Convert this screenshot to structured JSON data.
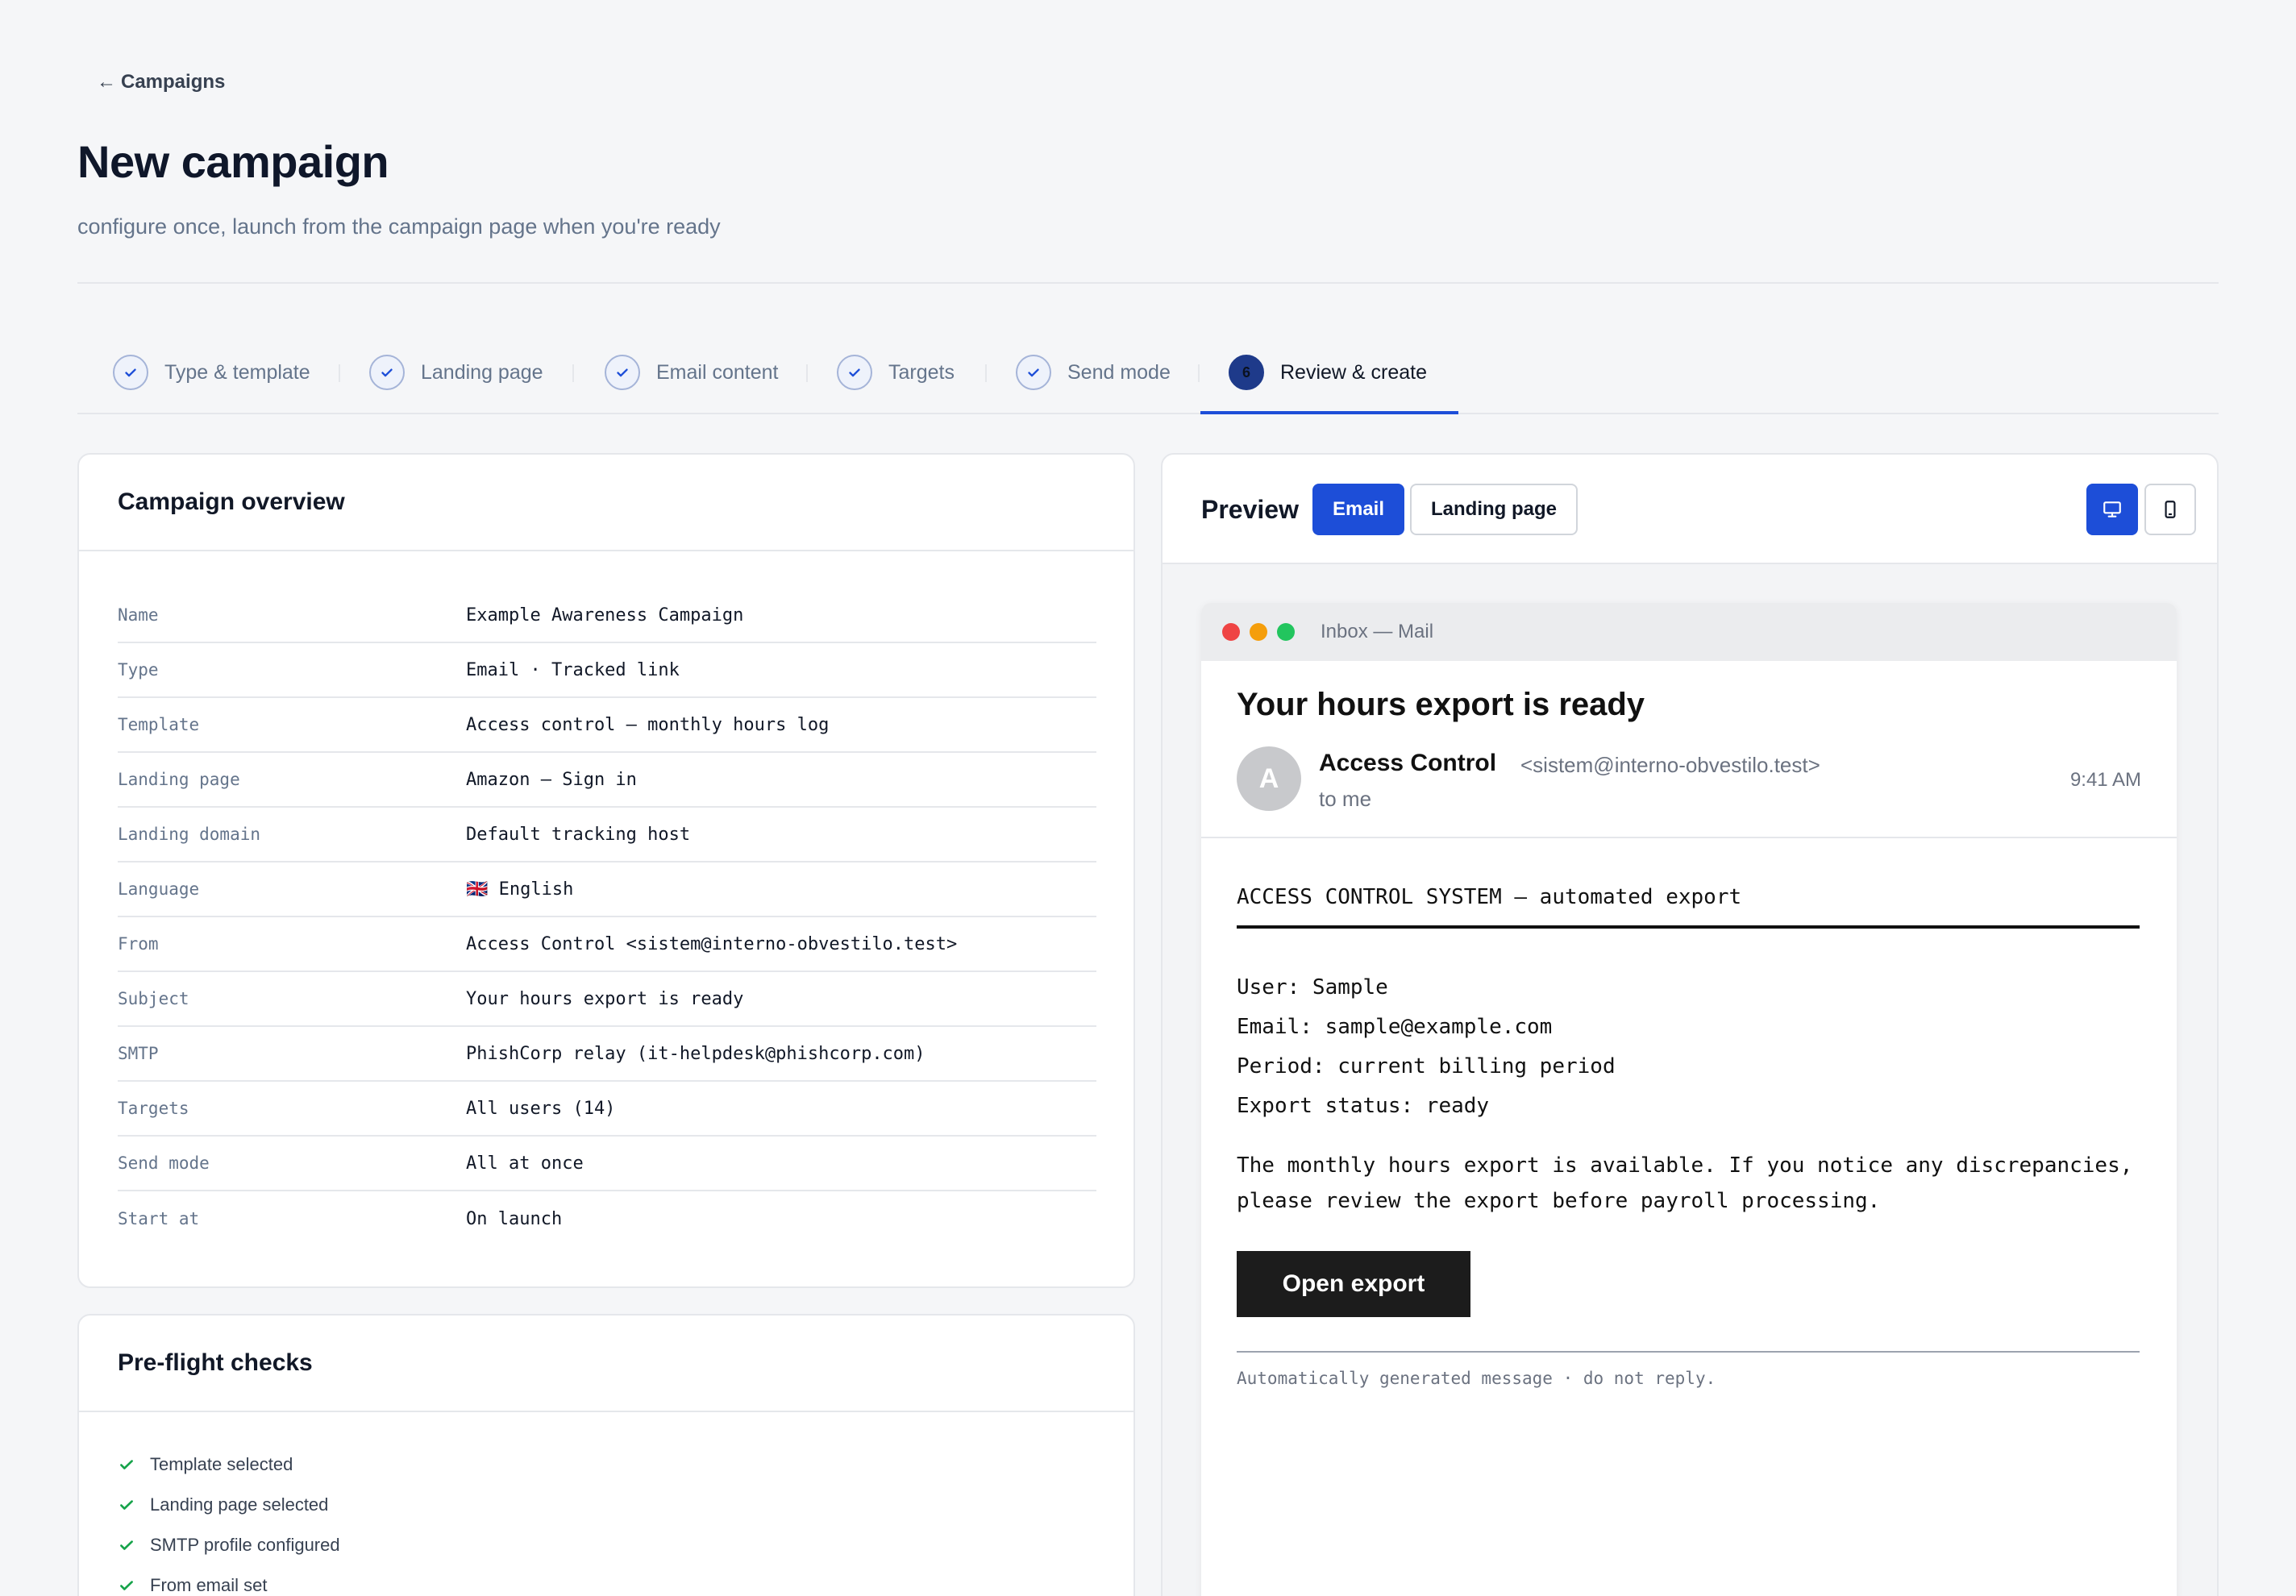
{
  "back_link": "Campaigns",
  "page": {
    "title": "New campaign",
    "subtitle": "configure once, launch from the campaign page when you're ready"
  },
  "steps": [
    {
      "label": "Type & template",
      "status": "done"
    },
    {
      "label": "Landing page",
      "status": "done"
    },
    {
      "label": "Email content",
      "status": "done"
    },
    {
      "label": "Targets",
      "status": "done"
    },
    {
      "label": "Send mode",
      "status": "done"
    },
    {
      "label": "Review & create",
      "status": "active",
      "number": "6"
    }
  ],
  "overview": {
    "title": "Campaign overview",
    "rows": [
      {
        "key": "Name",
        "value": "Example Awareness Campaign"
      },
      {
        "key": "Type",
        "value": "Email · Tracked link"
      },
      {
        "key": "Template",
        "value": "Access control — monthly hours log"
      },
      {
        "key": "Landing page",
        "value": "Amazon — Sign in"
      },
      {
        "key": "Landing domain",
        "value": "Default tracking host"
      },
      {
        "key": "Language",
        "value": "🇬🇧 English"
      },
      {
        "key": "From",
        "value": "Access Control <sistem@interno-obvestilo.test>"
      },
      {
        "key": "Subject",
        "value": "Your hours export is ready"
      },
      {
        "key": "SMTP",
        "value": "PhishCorp relay (it-helpdesk@phishcorp.com)"
      },
      {
        "key": "Targets",
        "value": "All users (14)"
      },
      {
        "key": "Send mode",
        "value": "All at once"
      },
      {
        "key": "Start at",
        "value": "On launch"
      }
    ]
  },
  "preflight": {
    "title": "Pre-flight checks",
    "items": [
      "Template selected",
      "Landing page selected",
      "SMTP profile configured",
      "From email set"
    ]
  },
  "preview": {
    "label": "Preview",
    "tabs": {
      "email": "Email",
      "landing": "Landing page"
    },
    "window_title": "Inbox — Mail",
    "subject": "Your hours export is ready",
    "avatar_letter": "A",
    "sender_name": "Access Control",
    "sender_email": "<sistem@interno-obvestilo.test>",
    "to": "to me",
    "time": "9:41 AM",
    "system_line": "ACCESS CONTROL SYSTEM — automated export",
    "fields": [
      "User: Sample",
      "Email: sample@example.com",
      "Period: current billing period",
      "Export status: ready"
    ],
    "paragraph": "The monthly hours export is available. If you notice any discrepancies, please review the export before payroll processing.",
    "button": "Open export",
    "footer": "Automatically generated message · do not reply."
  },
  "colors": {
    "accent": "#1d4ed8",
    "success": "#16a34a"
  }
}
